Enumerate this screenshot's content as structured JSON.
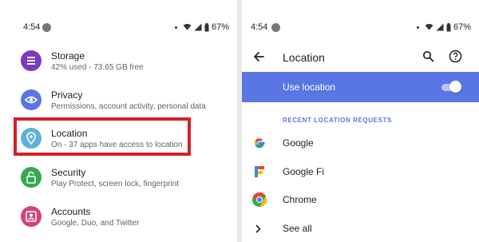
{
  "status_bar": {
    "time": "4:54",
    "battery": "67%"
  },
  "settings_list": [
    {
      "title": "Storage",
      "subtitle": "42% used - 73.65 GB free",
      "icon": "storage-icon",
      "color": "#7b39c6"
    },
    {
      "title": "Privacy",
      "subtitle": "Permissions, account activity, personal data",
      "icon": "privacy-eye-icon",
      "color": "#5a76e5"
    },
    {
      "title": "Location",
      "subtitle": "On - 37 apps have access to location",
      "icon": "location-pin-icon",
      "color": "#5fb2d6"
    },
    {
      "title": "Security",
      "subtitle": "Play Protect, screen lock, fingerprint",
      "icon": "lock-icon",
      "color": "#34a853"
    },
    {
      "title": "Accounts",
      "subtitle": "Google, Duo, and Twitter",
      "icon": "accounts-icon",
      "color": "#d4427a"
    }
  ],
  "location_page": {
    "title": "Location",
    "use_location_label": "Use location",
    "use_location_on": true,
    "recent_header": "RECENT LOCATION REQUESTS",
    "apps": [
      {
        "name": "Google",
        "icon": "google-g-icon"
      },
      {
        "name": "Google Fi",
        "icon": "google-fi-icon"
      },
      {
        "name": "Chrome",
        "icon": "chrome-icon"
      }
    ],
    "see_all_label": "See all"
  },
  "colors": {
    "accent": "#5a76e5",
    "highlight_border": "#d32029"
  }
}
